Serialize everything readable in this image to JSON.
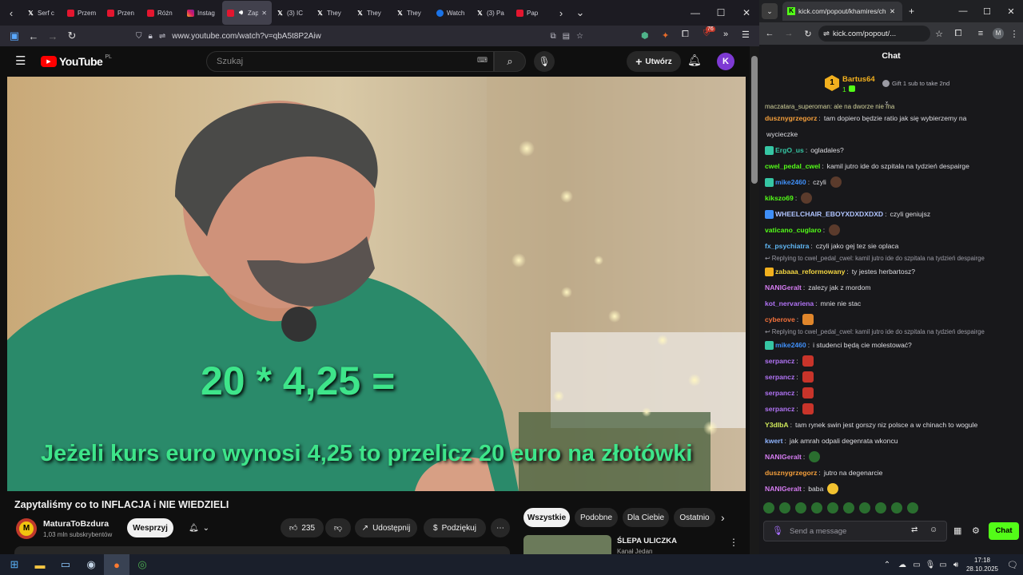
{
  "browser_left": {
    "tabs": [
      {
        "label": "Serf c",
        "icon": "x-icon"
      },
      {
        "label": "Przem",
        "icon": "youtube-icon"
      },
      {
        "label": "Przen",
        "icon": "youtube-icon"
      },
      {
        "label": "Różn",
        "icon": "youtube-icon"
      },
      {
        "label": "Instag",
        "icon": "instagram-icon"
      },
      {
        "label": "Zap",
        "icon": "youtube-icon",
        "active": true
      },
      {
        "label": "(3) IC",
        "icon": "x-icon"
      },
      {
        "label": "They",
        "icon": "x-icon"
      },
      {
        "label": "They",
        "icon": "x-icon"
      },
      {
        "label": "They",
        "icon": "x-icon"
      },
      {
        "label": "Watch",
        "icon": "google-icon"
      },
      {
        "label": "(3) Pa",
        "icon": "x-icon"
      },
      {
        "label": "Pap",
        "icon": "youtube-icon"
      }
    ],
    "url": "www.youtube.com/watch?v=qbA5t8P2Aiw",
    "badge_count": "76"
  },
  "youtube": {
    "logo_text": "YouTube",
    "logo_region": "PL",
    "search_placeholder": "Szukaj",
    "create_label": "Utwórz",
    "avatar_letter": "K",
    "video_overlay_eq": "20 * 4,25 =",
    "video_overlay_text": "Jeżeli kurs euro wynosi 4,25 to przelicz 20 euro na złotówki",
    "video_title": "Zapytaliśmy co to INFLACJA i NIE WIEDZIELI",
    "channel_name": "MaturaToBzdura",
    "channel_subs": "1,03 mln subskrybentów",
    "channel_initial": "M",
    "support_label": "Wesprzyj",
    "likes": "235",
    "share_label": "Udostępnij",
    "thanks_label": "Podziękuj",
    "filter_chips": [
      "Wszystkie",
      "Podobne",
      "Dla Ciebie",
      "Ostatnio"
    ],
    "rec_title": "ŚLEPA ULICZKA",
    "rec_channel": "Kanał Jedan"
  },
  "browser_right": {
    "url": "kick.com/popout/...",
    "tab_title": "kick.com/popout/khamires/cha",
    "profile_letter": "M"
  },
  "kick": {
    "chat_title": "Chat",
    "top_gifter_rank": "1",
    "top_gifter_name": "Bartus64",
    "top_gifter_count": "1",
    "gift_prompt": "Gift 1 sub to take 2nd",
    "partial_top": "maczatara_superoman: ale na dworze nie ma",
    "messages": [
      {
        "user": "dusznygrzegorz",
        "color": "#f59f3b",
        "text": "tam dopiero będzie ratio jak się wybierzemy na"
      },
      {
        "user": "",
        "color": "#f59f3b",
        "text": "wycieczke",
        "cont": true
      },
      {
        "user": "ErgO_us",
        "color": "#36c6a4",
        "text": "ogladales?",
        "badge": "#36c6a4"
      },
      {
        "user": "cwel_pedal_cwel",
        "color": "#53fc18",
        "text": "kamil jutro ide do szpitala na tydzień despairge"
      },
      {
        "user": "mike2460",
        "color": "#3f8ff8",
        "text": "czyli",
        "badge": "#36c6a4",
        "emote": "face"
      },
      {
        "user": "kikszo69",
        "color": "#53fc18",
        "text": "",
        "emote": "face"
      },
      {
        "user": "WHEELCHAIR_EBOYXDXDXDXD",
        "color": "#b0c4ff",
        "text": "czyli geniujsz",
        "badge": "#3f8ff8"
      },
      {
        "user": "vaticano_cuglaro",
        "color": "#53fc18",
        "text": "",
        "emote": "face"
      },
      {
        "user": "fx_psychiatra",
        "color": "#5fb6f3",
        "text": "czyli jako gej tez sie oplaca"
      },
      {
        "reply": "Replying to cwel_pedal_cwel: kamil jutro ide do szpitala na tydzień despairge"
      },
      {
        "user": "zabaaa_reformowany",
        "color": "#f5d742",
        "text": "ty jestes herbartosz?",
        "badge": "#f2b01e"
      },
      {
        "user": "NANIGeralt",
        "color": "#d67cf2",
        "text": "zalezy jak z mordom"
      },
      {
        "user": "kot_nervariena",
        "color": "#b173f5",
        "text": "mnie nie stac"
      },
      {
        "user": "cyberove",
        "color": "#f6723b",
        "text": "",
        "emote": "orange"
      },
      {
        "reply": "Replying to cwel_pedal_cwel: kamil jutro ide do szpitala na tydzień despairge"
      },
      {
        "user": "mike2460",
        "color": "#3f8ff8",
        "text": "i studenci będą cie molestować?",
        "badge": "#36c6a4"
      },
      {
        "user": "serpancz",
        "color": "#b173f5",
        "text": "",
        "emote": "red"
      },
      {
        "user": "serpancz",
        "color": "#b173f5",
        "text": "",
        "emote": "red"
      },
      {
        "user": "serpancz",
        "color": "#b173f5",
        "text": "",
        "emote": "red"
      },
      {
        "user": "serpancz",
        "color": "#b173f5",
        "text": "",
        "emote": "red"
      },
      {
        "user": "Y3dIbA",
        "color": "#cfe85a",
        "text": "tam rynek swin jest gorszy niz polsce a w chinach to wogule"
      },
      {
        "user": "kwert",
        "color": "#8fb4ff",
        "text": "jak amrah odpali degenrata wkoncu"
      },
      {
        "user": "NANIGeralt",
        "color": "#d67cf2",
        "text": "",
        "emote": "frog"
      },
      {
        "user": "dusznygrzegorz",
        "color": "#f59f3b",
        "text": "jutro na degenarcie"
      },
      {
        "user": "NANIGeralt",
        "color": "#d67cf2",
        "text": "baba",
        "emote": "yellow"
      }
    ],
    "input_placeholder": "Send a message",
    "chat_button": "Chat"
  },
  "taskbar": {
    "time": "17:18",
    "date": "28.10.2025"
  }
}
